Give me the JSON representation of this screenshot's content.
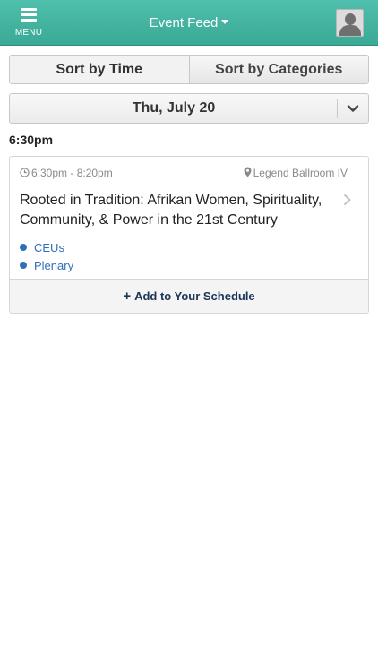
{
  "header": {
    "menu_label": "MENU",
    "title": "Event Feed",
    "menu_icon": "hamburger-icon",
    "dropdown_icon": "caret-down-icon",
    "profile_icon": "user-avatar-icon",
    "bar_color": "#43b4a0"
  },
  "sort": {
    "by_time": "Sort by Time",
    "by_categories": "Sort by Categories",
    "selected": "by_time"
  },
  "date_selector": {
    "value": "Thu, July 20",
    "icon": "chevron-down-icon"
  },
  "time_group": "6:30pm",
  "event": {
    "time_range": "6:30pm - 8:20pm",
    "location": "Legend Ballroom IV",
    "title": "Rooted in Tradition: Afrikan Women, Spirituality, Community, & Power in the 21st Century",
    "tags": [
      "CEUs",
      "Plenary"
    ],
    "tag_color": "#2f6fba",
    "add_label": "Add to Your Schedule",
    "add_icon": "plus-icon",
    "clock_icon": "clock-icon",
    "location_icon": "map-pin-icon",
    "detail_icon": "chevron-right-icon"
  }
}
